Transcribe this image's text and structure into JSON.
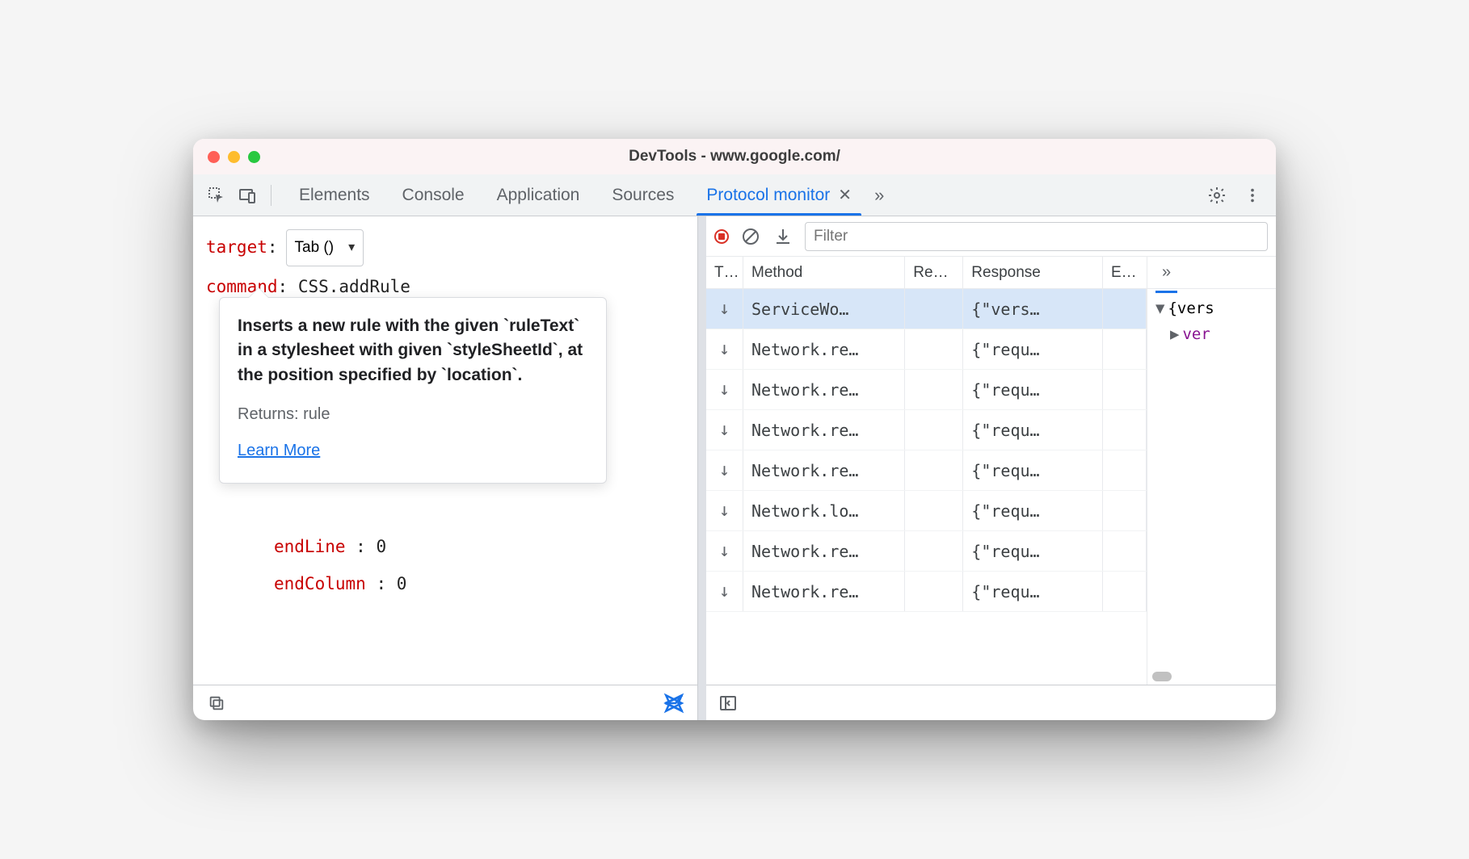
{
  "window": {
    "title": "DevTools - www.google.com/"
  },
  "toolbar": {
    "tabs": [
      "Elements",
      "Console",
      "Application",
      "Sources",
      "Protocol monitor"
    ],
    "active_tab_index": 4
  },
  "editor": {
    "target_label": "target",
    "target_value": "Tab ()",
    "command_label": "command",
    "command_value": "CSS.addRule",
    "param_endLine_key": "endLine",
    "param_endLine_val": "0",
    "param_endColumn_key": "endColumn",
    "param_endColumn_val": "0"
  },
  "tooltip": {
    "desc": "Inserts a new rule with the given `ruleText` in a stylesheet with given `styleSheetId`, at the position specified by `location`.",
    "returns": "Returns: rule",
    "link": "Learn More"
  },
  "protocol": {
    "filter_placeholder": "Filter",
    "columns": {
      "t": "T…",
      "method": "Method",
      "re": "Re…",
      "response": "Response",
      "e": "E…"
    },
    "rows": [
      {
        "method": "ServiceWo…",
        "response": "{\"vers…",
        "selected": true
      },
      {
        "method": "Network.re…",
        "response": "{\"requ…"
      },
      {
        "method": "Network.re…",
        "response": "{\"requ…"
      },
      {
        "method": "Network.re…",
        "response": "{\"requ…"
      },
      {
        "method": "Network.re…",
        "response": "{\"requ…"
      },
      {
        "method": "Network.lo…",
        "response": "{\"requ…"
      },
      {
        "method": "Network.re…",
        "response": "{\"requ…"
      },
      {
        "method": "Network.re…",
        "response": "{\"requ…"
      }
    ],
    "detail_root": "{vers",
    "detail_key": "ver"
  }
}
